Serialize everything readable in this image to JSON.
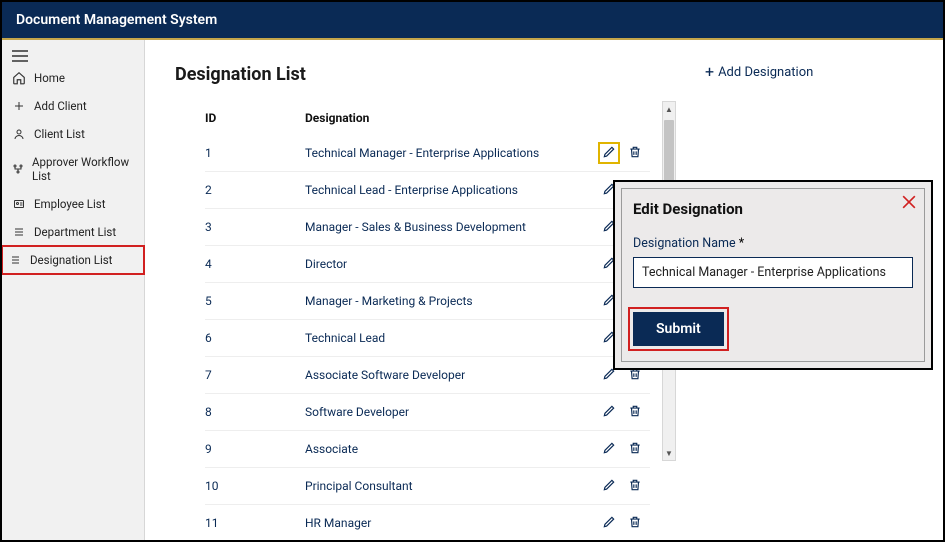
{
  "header": {
    "title": "Document Management System"
  },
  "sidebar": {
    "items": [
      {
        "icon": "home",
        "label": "Home"
      },
      {
        "icon": "plus",
        "label": "Add Client"
      },
      {
        "icon": "person",
        "label": "Client List"
      },
      {
        "icon": "flow",
        "label": "Approver Workflow List"
      },
      {
        "icon": "card",
        "label": "Employee List"
      },
      {
        "icon": "list",
        "label": "Department List"
      },
      {
        "icon": "list",
        "label": "Designation List"
      }
    ]
  },
  "page": {
    "title": "Designation List",
    "add_label": "Add Designation",
    "columns": {
      "id": "ID",
      "designation": "Designation"
    },
    "rows": [
      {
        "id": "1",
        "designation": "Technical Manager - Enterprise Applications"
      },
      {
        "id": "2",
        "designation": "Technical Lead - Enterprise Applications"
      },
      {
        "id": "3",
        "designation": "Manager - Sales & Business Development"
      },
      {
        "id": "4",
        "designation": "Director"
      },
      {
        "id": "5",
        "designation": "Manager - Marketing & Projects"
      },
      {
        "id": "6",
        "designation": "Technical Lead"
      },
      {
        "id": "7",
        "designation": "Associate Software Developer"
      },
      {
        "id": "8",
        "designation": "Software Developer"
      },
      {
        "id": "9",
        "designation": "Associate"
      },
      {
        "id": "10",
        "designation": "Principal Consultant"
      },
      {
        "id": "11",
        "designation": "HR Manager"
      }
    ]
  },
  "modal": {
    "title": "Edit Designation",
    "field_label": "Designation Name",
    "required_mark": "*",
    "field_value": "Technical Manager - Enterprise Applications",
    "submit_label": "Submit"
  }
}
